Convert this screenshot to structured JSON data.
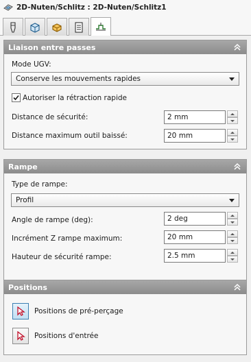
{
  "window": {
    "title": "2D-Nuten/Schlitz : 2D-Nuten/Schlitz1"
  },
  "tabs": [
    {
      "name": "tool-tab",
      "icon": "tool-icon"
    },
    {
      "name": "model-tab",
      "icon": "3d-box-icon"
    },
    {
      "name": "stock-tab",
      "icon": "stock-icon"
    },
    {
      "name": "parameters-tab",
      "icon": "list-icon"
    },
    {
      "name": "linking-tab",
      "icon": "linking-icon",
      "active": true
    }
  ],
  "linking": {
    "title": "Liaison entre passes",
    "mode_label": "Mode UGV:",
    "mode_value": "Conserve les mouvements rapides",
    "rapid_retract_label": "Autoriser la rétraction rapide",
    "rapid_retract_checked": true,
    "safe_distance_label": "Distance de sécurité:",
    "safe_distance_value": "2 mm",
    "max_stay_down_label": "Distance maximum outil baissé:",
    "max_stay_down_value": "20 mm"
  },
  "ramp": {
    "title": "Rampe",
    "type_label": "Type de rampe:",
    "type_value": "Profil",
    "angle_label": "Angle de rampe (deg):",
    "angle_value": "2 deg",
    "max_stepdown_label": "Incrément Z rampe maximum:",
    "max_stepdown_value": "20 mm",
    "clearance_label": "Hauteur de sécurité rampe:",
    "clearance_value": "2.5 mm"
  },
  "positions": {
    "title": "Positions",
    "predrill_label": "Positions de pré-perçage",
    "entry_label": "Positions d'entrée"
  },
  "colors": {
    "header": "#9a9a9a",
    "accent": "#3c7fb1",
    "cursor_red": "#c0102a"
  }
}
